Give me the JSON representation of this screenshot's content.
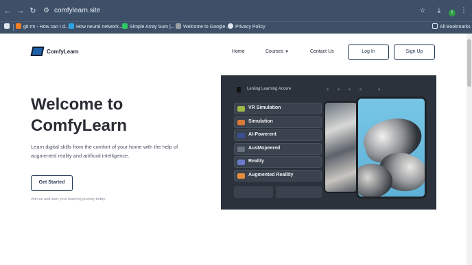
{
  "browser": {
    "url": "comfylearn.site",
    "bookmarks": [
      {
        "label": "git rm - How can I d...",
        "icon": "stackoverflow-icon",
        "color": "#f48024"
      },
      {
        "label": "How neural network...",
        "icon": "site-icon",
        "color": "#2aa4e3"
      },
      {
        "label": "Simple Array Sum |...",
        "icon": "hackerrank-icon",
        "color": "#2ec866"
      },
      {
        "label": "Welcome to Google...",
        "icon": "google-icon",
        "color": "#9aa0a6"
      },
      {
        "label": "Privacy Policy",
        "icon": "globe-icon",
        "color": "#dfe6ee"
      }
    ],
    "all_bookmarks": "All Bookmarks",
    "profile_initial": "I"
  },
  "header": {
    "brand": "ComfyLearn",
    "nav": {
      "home": "Home",
      "courses": "Courses",
      "contact": "Contact Us"
    },
    "login": "Log In",
    "signup": "Sign Up"
  },
  "hero": {
    "title_line1": "Welcome to",
    "title_line2": "ComfyLearn",
    "description": "Learn digital skills from the comfort of your home with the help of augmented reality and artificial intelligence.",
    "cta": "Get Started",
    "note": "Join us and start your learning journey today."
  },
  "hero_image": {
    "title": "Lenling Learning Acovre",
    "menu": [
      {
        "label": "VR Simulation",
        "color": "#9fb84a"
      },
      {
        "label": "Simulation",
        "color": "#d77a3a"
      },
      {
        "label": "AI-Powerent",
        "color": "#3c4f8f"
      },
      {
        "label": "AusMopeered",
        "color": "#6a7380"
      },
      {
        "label": "Reality",
        "color": "#6b7bc9"
      },
      {
        "label": "Augmented Reallity",
        "color": "#e58d3d"
      }
    ]
  },
  "colors": {
    "chrome": "#3d5068",
    "accent": "#1f3654"
  }
}
